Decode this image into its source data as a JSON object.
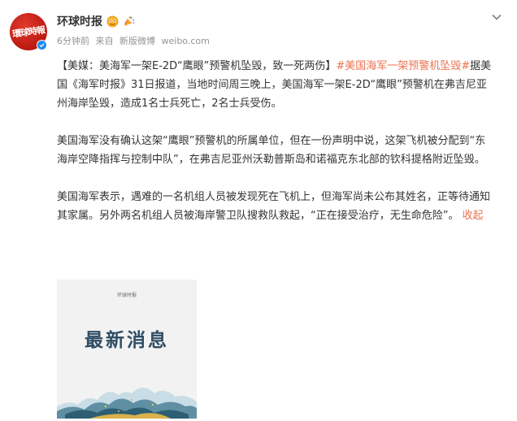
{
  "post": {
    "author": {
      "name": "环球时报",
      "avatar_text": "環球時報",
      "badges": [
        "gold-face-emoji-icon",
        "party-popper-icon"
      ]
    },
    "meta": {
      "time": "6分钟前",
      "source_prefix": "来自",
      "source": "新版微博",
      "site": "weibo.com"
    },
    "paragraphs": [
      {
        "title": "【美媒：美海军一架E-2D“鹰眼”预警机坠毁，致一死两伤】",
        "topic": "#美国海军一架预警机坠毁#",
        "body": "据美国《海军时报》31日报道，当地时间周三晚上，美国海军一架E-2D“鹰眼”预警机在弗吉尼亚州海岸坠毁，造成1名士兵死亡，2名士兵受伤。"
      },
      {
        "body": "美国海军没有确认这架“鹰眼”预警机的所属单位，但在一份声明中说，这架飞机被分配到“东海岸空降指挥与控制中队”，在弗吉尼亚州沃勒普斯岛和诺福克东北部的钦科提格附近坠毁。"
      },
      {
        "body": "美国海军表示，遇难的一名机组人员被发现死在飞机上，但海军尚未公布其姓名，正等待通知其家属。另外两名机组人员被海岸警卫队搜救队救起，“正在接受治疗，无生命危险”。",
        "collapse_label": "收起"
      }
    ],
    "image": {
      "small_text": "环球时报",
      "title": "最新消息"
    }
  },
  "colors": {
    "accent": "#eb7350",
    "avatar_red": "#c8201a",
    "verified_blue": "#1d8cf0",
    "meta_gray": "#939393",
    "text": "#333333",
    "thumb_title": "#2e4d64"
  }
}
